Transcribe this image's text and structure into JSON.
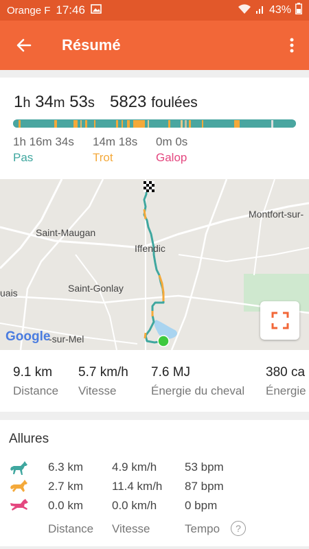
{
  "status_bar": {
    "carrier": "Orange F",
    "time": "17:46",
    "battery": "43%"
  },
  "app_bar": {
    "title": "Résumé"
  },
  "summary": {
    "duration": {
      "h": "1",
      "h_unit": "h",
      "m": "34",
      "m_unit": "m",
      "s": "53",
      "s_unit": "s"
    },
    "strides_value": "5823",
    "strides_label": "foulées",
    "gaits": [
      {
        "time": "1h 16m 34s",
        "label": "Pas",
        "color": "#3fa79f"
      },
      {
        "time": "14m 18s",
        "label": "Trot",
        "color": "#f4a93a"
      },
      {
        "time": "0m 0s",
        "label": "Galop",
        "color": "#e4477f"
      }
    ]
  },
  "map": {
    "places": [
      "Saint-Maugan",
      "Iffendic",
      "Montfort-sur-",
      "Saint-Gonlay",
      "uais",
      "-sur-Mel"
    ],
    "google_logo": "Google"
  },
  "stats": [
    {
      "value": "9.1 km",
      "label": "Distance"
    },
    {
      "value": "5.7 km/h",
      "label": "Vitesse"
    },
    {
      "value": "7.6 MJ",
      "label": "Énergie du cheval"
    },
    {
      "value": "380 ca",
      "label": "Énergie"
    }
  ],
  "allures": {
    "title": "Allures",
    "rows": [
      {
        "icon": "horse-walk-icon",
        "color": "#3fa79f",
        "distance": "6.3 km",
        "speed": "4.9 km/h",
        "tempo": "53 bpm"
      },
      {
        "icon": "horse-trot-icon",
        "color": "#f4a93a",
        "distance": "2.7 km",
        "speed": "11.4 km/h",
        "tempo": "87 bpm"
      },
      {
        "icon": "horse-gallop-icon",
        "color": "#e4477f",
        "distance": "0.0 km",
        "speed": "0.0 km/h",
        "tempo": "0 bpm"
      }
    ],
    "footer": {
      "distance": "Distance",
      "speed": "Vitesse",
      "tempo": "Tempo",
      "help": "?"
    }
  }
}
